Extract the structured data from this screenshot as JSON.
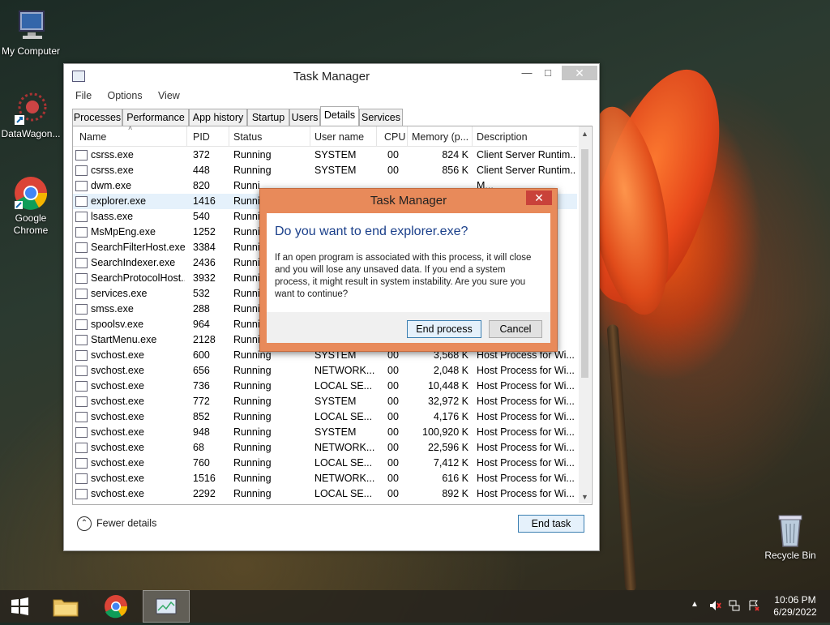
{
  "desktop": {
    "icons": [
      {
        "label": "My Computer"
      },
      {
        "label": "DataWagon..."
      },
      {
        "label": "Google Chrome"
      },
      {
        "label": "Recycle Bin"
      }
    ]
  },
  "taskmanager": {
    "title": "Task Manager",
    "menu": [
      "File",
      "Options",
      "View"
    ],
    "tabs": [
      "Processes",
      "Performance",
      "App history",
      "Startup",
      "Users",
      "Details",
      "Services"
    ],
    "active_tab": "Details",
    "columns": [
      "Name",
      "PID",
      "Status",
      "User name",
      "CPU",
      "Memory (p...",
      "Description"
    ],
    "rows": [
      {
        "name": "csrss.exe",
        "pid": "372",
        "status": "Running",
        "user": "SYSTEM",
        "cpu": "00",
        "mem": "824 K",
        "desc": "Client Server Runtim..."
      },
      {
        "name": "csrss.exe",
        "pid": "448",
        "status": "Running",
        "user": "SYSTEM",
        "cpu": "00",
        "mem": "856 K",
        "desc": "Client Server Runtim..."
      },
      {
        "name": "dwm.exe",
        "pid": "820",
        "status": "Runni",
        "user": "",
        "cpu": "",
        "mem": "",
        "desc": "M..."
      },
      {
        "name": "explorer.exe",
        "pid": "1416",
        "status": "Runni",
        "user": "",
        "cpu": "",
        "mem": "",
        "desc": ""
      },
      {
        "name": "lsass.exe",
        "pid": "540",
        "status": "Runni",
        "user": "",
        "cpu": "",
        "mem": "",
        "desc": ""
      },
      {
        "name": "MsMpEng.exe",
        "pid": "1252",
        "status": "Runni",
        "user": "",
        "cpu": "",
        "mem": "",
        "desc": ""
      },
      {
        "name": "SearchFilterHost.exe",
        "pid": "3384",
        "status": "Runni",
        "user": "",
        "cpu": "",
        "mem": "",
        "desc": "s ..."
      },
      {
        "name": "SearchIndexer.exe",
        "pid": "2436",
        "status": "Runni",
        "user": "",
        "cpu": "",
        "mem": "",
        "desc": "s ..."
      },
      {
        "name": "SearchProtocolHost....",
        "pid": "3932",
        "status": "Runni",
        "user": "",
        "cpu": "",
        "mem": "",
        "desc": "s ..."
      },
      {
        "name": "services.exe",
        "pid": "532",
        "status": "Runni",
        "user": "",
        "cpu": "",
        "mem": "",
        "desc": "ol..."
      },
      {
        "name": "smss.exe",
        "pid": "288",
        "status": "Runni",
        "user": "",
        "cpu": "",
        "mem": "",
        "desc": "s ..."
      },
      {
        "name": "spoolsv.exe",
        "pid": "964",
        "status": "Runni",
        "user": "",
        "cpu": "",
        "mem": "",
        "desc": "s ..."
      },
      {
        "name": "StartMenu.exe",
        "pid": "2128",
        "status": "Runni",
        "user": "",
        "cpu": "",
        "mem": "",
        "desc": ""
      },
      {
        "name": "svchost.exe",
        "pid": "600",
        "status": "Running",
        "user": "SYSTEM",
        "cpu": "00",
        "mem": "3,568 K",
        "desc": "Host Process for Wi..."
      },
      {
        "name": "svchost.exe",
        "pid": "656",
        "status": "Running",
        "user": "NETWORK...",
        "cpu": "00",
        "mem": "2,048 K",
        "desc": "Host Process for Wi..."
      },
      {
        "name": "svchost.exe",
        "pid": "736",
        "status": "Running",
        "user": "LOCAL SE...",
        "cpu": "00",
        "mem": "10,448 K",
        "desc": "Host Process for Wi..."
      },
      {
        "name": "svchost.exe",
        "pid": "772",
        "status": "Running",
        "user": "SYSTEM",
        "cpu": "00",
        "mem": "32,972 K",
        "desc": "Host Process for Wi..."
      },
      {
        "name": "svchost.exe",
        "pid": "852",
        "status": "Running",
        "user": "LOCAL SE...",
        "cpu": "00",
        "mem": "4,176 K",
        "desc": "Host Process for Wi..."
      },
      {
        "name": "svchost.exe",
        "pid": "948",
        "status": "Running",
        "user": "SYSTEM",
        "cpu": "00",
        "mem": "100,920 K",
        "desc": "Host Process for Wi..."
      },
      {
        "name": "svchost.exe",
        "pid": "68",
        "status": "Running",
        "user": "NETWORK...",
        "cpu": "00",
        "mem": "22,596 K",
        "desc": "Host Process for Wi..."
      },
      {
        "name": "svchost.exe",
        "pid": "760",
        "status": "Running",
        "user": "LOCAL SE...",
        "cpu": "00",
        "mem": "7,412 K",
        "desc": "Host Process for Wi..."
      },
      {
        "name": "svchost.exe",
        "pid": "1516",
        "status": "Running",
        "user": "NETWORK...",
        "cpu": "00",
        "mem": "616 K",
        "desc": "Host Process for Wi..."
      },
      {
        "name": "svchost.exe",
        "pid": "2292",
        "status": "Running",
        "user": "LOCAL SE...",
        "cpu": "00",
        "mem": "892 K",
        "desc": "Host Process for Wi..."
      }
    ],
    "fewer_details": "Fewer details",
    "end_task": "End task"
  },
  "dialog": {
    "title": "Task Manager",
    "question": "Do you want to end explorer.exe?",
    "message": "If an open program is associated with this process, it will close and you will lose any unsaved data. If you end a system process, it might result in system instability. Are you sure you want to continue?",
    "end_process": "End process",
    "cancel": "Cancel"
  },
  "tray": {
    "time": "10:06 PM",
    "date": "6/29/2022"
  },
  "colors": {
    "dialog_frame": "#e88a5a",
    "dialog_close": "#c9423a",
    "question_text": "#1a3f8a",
    "selection": "#e5f1fb"
  }
}
